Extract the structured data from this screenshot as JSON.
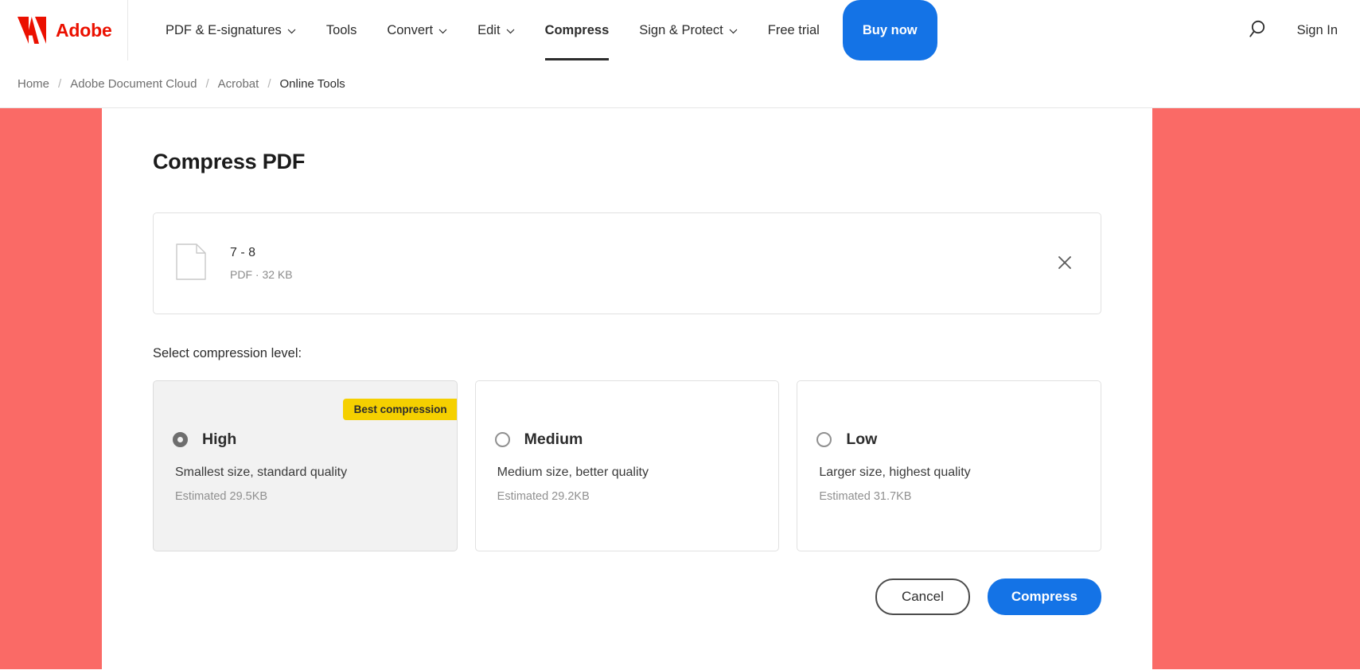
{
  "brand": {
    "name": "Adobe",
    "logo_icon": "adobe-logo-icon",
    "logo_color": "#eb1000"
  },
  "topnav": {
    "items": [
      {
        "label": "PDF & E-signatures",
        "has_chevron": true,
        "active": false
      },
      {
        "label": "Tools",
        "has_chevron": false,
        "active": false
      },
      {
        "label": "Convert",
        "has_chevron": true,
        "active": false
      },
      {
        "label": "Edit",
        "has_chevron": true,
        "active": false
      },
      {
        "label": "Compress",
        "has_chevron": false,
        "active": true
      },
      {
        "label": "Sign & Protect",
        "has_chevron": true,
        "active": false
      },
      {
        "label": "Free trial",
        "has_chevron": false,
        "active": false
      }
    ],
    "buy_label": "Buy now",
    "buy_color": "#1473e6",
    "search_icon": "search-icon",
    "signin_label": "Sign In"
  },
  "breadcrumb": {
    "separator": "/",
    "items": [
      {
        "label": "Home",
        "current": false
      },
      {
        "label": "Adobe Document Cloud",
        "current": false
      },
      {
        "label": "Acrobat",
        "current": false
      },
      {
        "label": "Online Tools",
        "current": true
      }
    ]
  },
  "side_panel_color": "#fa6a66",
  "main": {
    "title": "Compress PDF",
    "file": {
      "icon": "document-icon",
      "name": "7 - 8",
      "details": "PDF · 32 KB",
      "close_icon": "close-icon"
    },
    "level_label": "Select compression level:",
    "options": [
      {
        "id": "high",
        "title": "High",
        "description": "Smallest size, standard quality",
        "estimate": "Estimated 29.5KB",
        "badge": "Best compression",
        "badge_color": "#f5d000",
        "selected": true
      },
      {
        "id": "medium",
        "title": "Medium",
        "description": "Medium size, better quality",
        "estimate": "Estimated 29.2KB",
        "badge": null,
        "selected": false
      },
      {
        "id": "low",
        "title": "Low",
        "description": "Larger size, highest quality",
        "estimate": "Estimated 31.7KB",
        "badge": null,
        "selected": false
      }
    ],
    "actions": {
      "cancel_label": "Cancel",
      "compress_label": "Compress",
      "compress_color": "#1473e6"
    }
  }
}
